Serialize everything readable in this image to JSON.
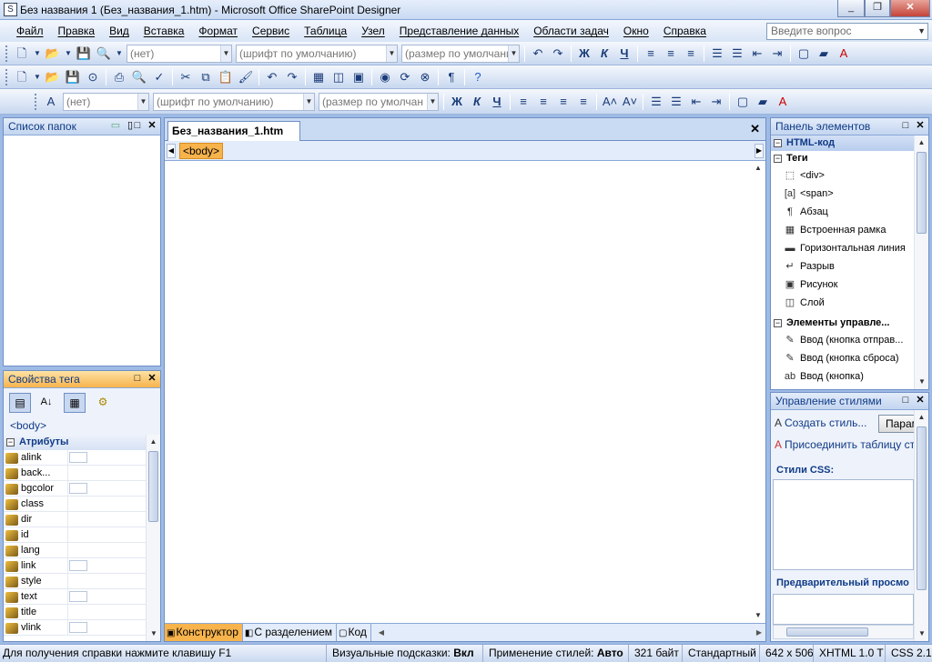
{
  "window": {
    "title": "Без названия 1 (Без_названия_1.htm) - Microsoft Office SharePoint Designer",
    "btn_min": "_",
    "btn_max": "❐",
    "btn_close": "✕"
  },
  "menu": {
    "items": [
      "Файл",
      "Правка",
      "Вид",
      "Вставка",
      "Формат",
      "Сервис",
      "Таблица",
      "Узел",
      "Представление данных",
      "Области задач",
      "Окно",
      "Справка"
    ],
    "ask_placeholder": "Введите вопрос"
  },
  "toolbar1": {
    "style_combo": "(нет)",
    "font_combo": "(шрифт по умолчанию)",
    "size_combo": "(размер по умолчанию)",
    "bold": "Ж",
    "italic": "К",
    "underline": "Ч"
  },
  "toolbar3": {
    "style_combo": "(нет)",
    "font_combo": "(шрифт по умолчанию)",
    "size_combo": "(размер по умолчан",
    "bold": "Ж",
    "italic": "К",
    "underline": "Ч"
  },
  "folder_list": {
    "title": "Список папок"
  },
  "tag_props": {
    "title": "Свойства тега",
    "current_tag": "<body>",
    "section": "Атрибуты",
    "attributes": [
      {
        "name": "alink",
        "checkbox": true
      },
      {
        "name": "back...",
        "checkbox": false
      },
      {
        "name": "bgcolor",
        "checkbox": true
      },
      {
        "name": "class",
        "checkbox": false
      },
      {
        "name": "dir",
        "checkbox": false
      },
      {
        "name": "id",
        "checkbox": false
      },
      {
        "name": "lang",
        "checkbox": false
      },
      {
        "name": "link",
        "checkbox": true
      },
      {
        "name": "style",
        "checkbox": false
      },
      {
        "name": "text",
        "checkbox": true
      },
      {
        "name": "title",
        "checkbox": false
      },
      {
        "name": "vlink",
        "checkbox": true
      }
    ]
  },
  "editor": {
    "tab_label": "Без_названия_1.htm",
    "tag_chip": "<body>",
    "views": [
      {
        "label": "Конструктор",
        "active": true
      },
      {
        "label": "С разделением",
        "active": false
      },
      {
        "label": "Код",
        "active": false
      }
    ]
  },
  "toolbox": {
    "title": "Панель элементов",
    "section_html": "HTML-код",
    "group_tags": "Теги",
    "tags": [
      {
        "label": "<div>",
        "icon": "div-icon",
        "glyph": "⬚"
      },
      {
        "label": "<span>",
        "icon": "span-icon",
        "glyph": "[a]"
      },
      {
        "label": "Абзац",
        "icon": "paragraph-icon",
        "glyph": "¶"
      },
      {
        "label": "Встроенная рамка",
        "icon": "iframe-icon",
        "glyph": "▦"
      },
      {
        "label": "Горизонтальная линия",
        "icon": "hr-icon",
        "glyph": "▬"
      },
      {
        "label": "Разрыв",
        "icon": "break-icon",
        "glyph": "↵"
      },
      {
        "label": "Рисунок",
        "icon": "image-icon",
        "glyph": "▣"
      },
      {
        "label": "Слой",
        "icon": "layer-icon",
        "glyph": "◫"
      }
    ],
    "group_controls": "Элементы управле...",
    "controls": [
      {
        "label": "Ввод (кнопка отправ...",
        "icon": "submit-button-icon",
        "glyph": "✎"
      },
      {
        "label": "Ввод (кнопка сброса)",
        "icon": "reset-button-icon",
        "glyph": "✎"
      },
      {
        "label": "Ввод (кнопка)",
        "icon": "button-input-icon",
        "glyph": "ab"
      }
    ]
  },
  "styles_panel": {
    "title": "Управление стилями",
    "create_style": "Создать стиль...",
    "params_button": "Парам",
    "attach_sheet": "Присоединить таблицу ст",
    "css_label": "Стили CSS:",
    "preview_label": "Предварительный просмо"
  },
  "status": {
    "help": "Для получения справки нажмите клавишу F1",
    "visual_hints_label": "Визуальные подсказки:",
    "visual_hints_value": "Вкл",
    "style_apply_label": "Применение стилей:",
    "style_apply_value": "Авто",
    "size": "321 байт",
    "mode": "Стандартный",
    "dimensions": "642 x 506",
    "doctype": "XHTML 1.0 T",
    "css_version": "CSS 2.1"
  },
  "colors": {
    "accent": "#f7b34c",
    "frame": "#9ebbe6",
    "panel_title": "#0f3a86"
  }
}
